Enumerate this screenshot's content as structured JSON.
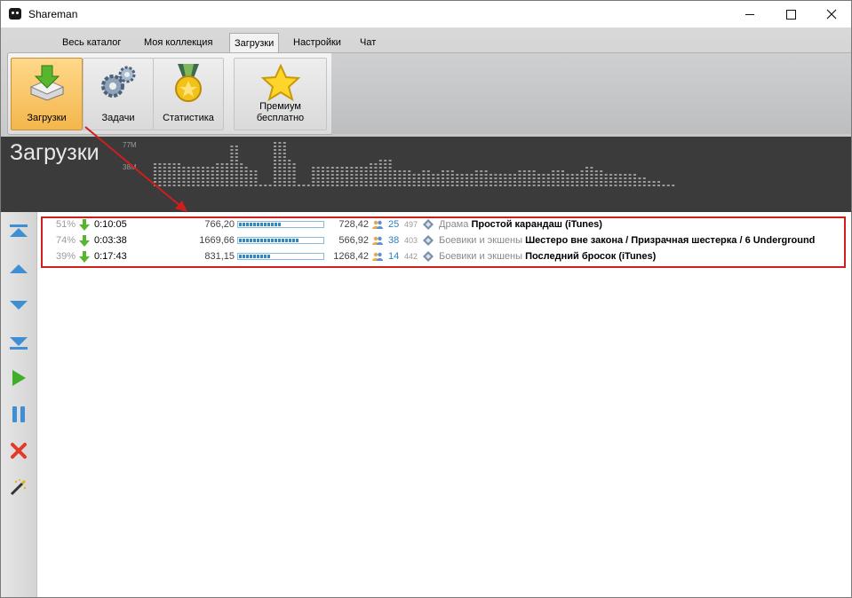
{
  "window": {
    "title": "Shareman"
  },
  "menu": {
    "tabs": [
      "Весь каталог",
      "Моя коллекция",
      "Загрузки",
      "Настройки",
      "Чат"
    ],
    "active": "Загрузки"
  },
  "ribbon": {
    "buttons": [
      "Загрузки",
      "Задачи",
      "Статистика"
    ],
    "premium_line1": "Премиум",
    "premium_line2": "бесплатно"
  },
  "header": {
    "title": "Загрузки",
    "scale_top": "77M",
    "scale_mid": "38M"
  },
  "downloads": [
    {
      "percent": "51%",
      "time": "0:10:05",
      "size": "766,20",
      "progress": 0.51,
      "downloaded": "728,42",
      "seeds": "25",
      "peers": "497",
      "genre": "Драма",
      "name": "Простой карандаш (iTunes)"
    },
    {
      "percent": "74%",
      "time": "0:03:38",
      "size": "1669,66",
      "progress": 0.74,
      "downloaded": "566,92",
      "seeds": "38",
      "peers": "403",
      "genre": "Боевики и экшены",
      "name": "Шестеро вне закона / Призрачная шестерка / 6 Underground"
    },
    {
      "percent": "39%",
      "time": "0:17:43",
      "size": "831,15",
      "progress": 0.39,
      "downloaded": "1268,42",
      "seeds": "14",
      "peers": "442",
      "genre": "Боевики и экшены",
      "name": "Последний бросок (iTunes)"
    }
  ],
  "icons": [
    "app-icon",
    "download-icon",
    "gears-icon",
    "medal-icon",
    "star-icon",
    "move-top-icon",
    "move-up-icon",
    "move-down-icon",
    "move-bottom-icon",
    "play-icon",
    "pause-icon",
    "delete-icon",
    "magic-wand-icon"
  ],
  "colors": {
    "accent_blue": "#2d8ac9",
    "highlight_red": "#d01d1d",
    "active_tab": "#f4b64c",
    "header_bg": "#3b3b3b"
  }
}
